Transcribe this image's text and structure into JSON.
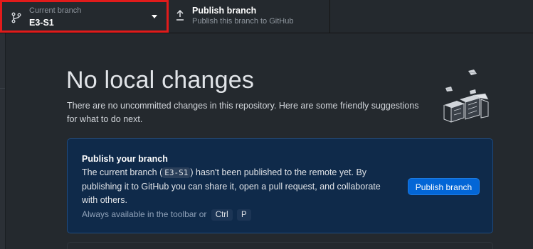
{
  "toolbar": {
    "branch": {
      "sublabel": "Current branch",
      "name": "E3-S1",
      "icon": "git-branch-icon"
    },
    "publish": {
      "title": "Publish branch",
      "subtitle": "Publish this branch to GitHub",
      "icon": "upload-icon"
    }
  },
  "main": {
    "heading": "No local changes",
    "description": "There are no uncommitted changes in this repository. Here are some friendly suggestions for what to do next.",
    "illustration": "empty-state-illustration"
  },
  "publish_card": {
    "title": "Publish your branch",
    "body_prefix": "The current branch (",
    "branch_code": "E3-S1",
    "body_suffix": ") hasn't been published to the remote yet. By publishing it to GitHub you can share it, open a pull request, and collaborate with others.",
    "hint": "Always available in the toolbar or",
    "shortcut_key1": "Ctrl",
    "shortcut_key2": "P",
    "button_label": "Publish branch"
  },
  "colors": {
    "background": "#24292e",
    "highlight_border": "#e11b1b",
    "card_bg": "#0f2a4a",
    "accent_button": "#0366d6"
  }
}
